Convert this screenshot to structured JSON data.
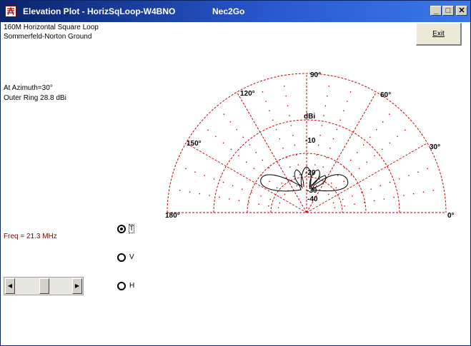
{
  "window": {
    "title": "Elevation Plot - HorizSqLoop-W4BNO",
    "app_name": "Nec2Go",
    "controls": {
      "minimize": "_",
      "maximize": "□",
      "close": "✕"
    }
  },
  "info": {
    "line1": "160M Horizontal Square Loop",
    "line2": "Sommerfeld-Norton Ground",
    "azimuth": "At Azimuth=30°",
    "outer_ring": "Outer Ring 28.8 dBi",
    "freq": "Freq = 21.3 MHz",
    "freq_color": "#800000"
  },
  "exit_button": {
    "label": "Exit"
  },
  "polarization": {
    "options": [
      {
        "label": "T",
        "selected": true
      },
      {
        "label": "V",
        "selected": false
      },
      {
        "label": "H",
        "selected": false
      }
    ]
  },
  "plot": {
    "grid_color": "#cc0000",
    "angle_labels": [
      "0°",
      "30°",
      "60°",
      "90°",
      "120°",
      "150°",
      "180°"
    ],
    "ring_labels": [
      "dBi",
      "-10",
      "-20",
      "-30",
      "-40"
    ]
  },
  "scrollbar": {
    "position": 0.5
  }
}
